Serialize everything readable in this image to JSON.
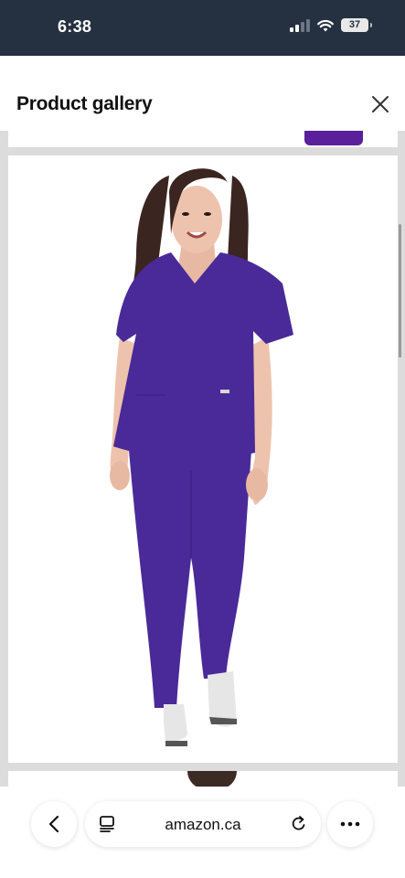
{
  "status_bar": {
    "time": "6:38",
    "battery": "37",
    "icons": [
      "cellular-signal-icon",
      "wifi-icon",
      "battery-icon"
    ]
  },
  "header": {
    "title": "Product gallery",
    "close_icon": "close-icon"
  },
  "gallery": {
    "main_image": "model-wearing-purple-scrubs",
    "colors": {
      "scrub": "#4a2a98",
      "background": "#dcdcdc"
    }
  },
  "browser_bar": {
    "url": "amazon.ca",
    "icons": [
      "back-icon",
      "tabs-icon",
      "reload-icon",
      "more-icon"
    ]
  }
}
